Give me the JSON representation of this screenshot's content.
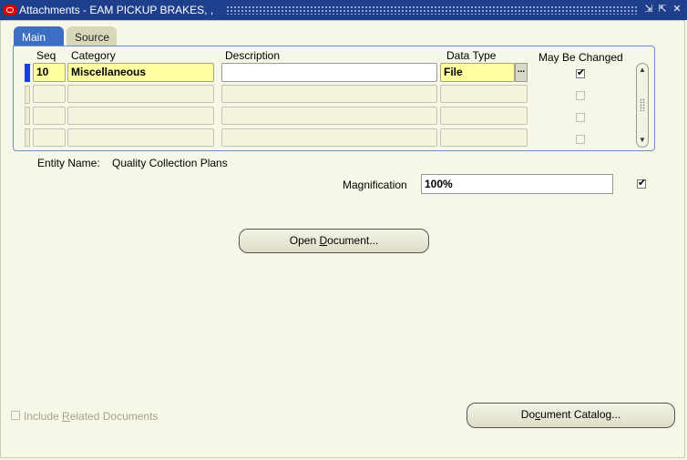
{
  "window": {
    "title": "Attachments - EAM PICKUP BRAKES, ,",
    "minimize": "⇲",
    "maximize": "⇱",
    "close": "✕"
  },
  "tabs": [
    {
      "label": "Main",
      "active": true
    },
    {
      "label": "Source",
      "active": false
    }
  ],
  "table": {
    "columns": {
      "seq": "Seq",
      "category": "Category",
      "description": "Description",
      "data_type": "Data Type",
      "may_be_changed": "May Be Changed"
    },
    "rows": [
      {
        "seq": "10",
        "category": "Miscellaneous",
        "description": "",
        "data_type": "File",
        "may_be_changed": true
      },
      {
        "seq": "",
        "category": "",
        "description": "",
        "data_type": "",
        "may_be_changed": false
      },
      {
        "seq": "",
        "category": "",
        "description": "",
        "data_type": "",
        "may_be_changed": false
      },
      {
        "seq": "",
        "category": "",
        "description": "",
        "data_type": "",
        "may_be_changed": false
      }
    ],
    "lov_button": "..."
  },
  "entity": {
    "label": "Entity Name:",
    "value": "Quality Collection Plans"
  },
  "magnification": {
    "label": "Magnification",
    "value": "100%",
    "checked": true
  },
  "buttons": {
    "open_document": {
      "pre": "Open ",
      "ul": "D",
      "post": "ocument..."
    },
    "document_catalog": {
      "pre": "Do",
      "ul": "c",
      "post": "ument Catalog..."
    }
  },
  "include_related": {
    "pre": "Include ",
    "ul": "R",
    "post": "elated Documents",
    "checked": false
  },
  "colors": {
    "titlebar": "#1d3f8c",
    "active_tab": "#3d6ec4",
    "required_field": "#ffffa0",
    "background": "#f7f7e7"
  }
}
